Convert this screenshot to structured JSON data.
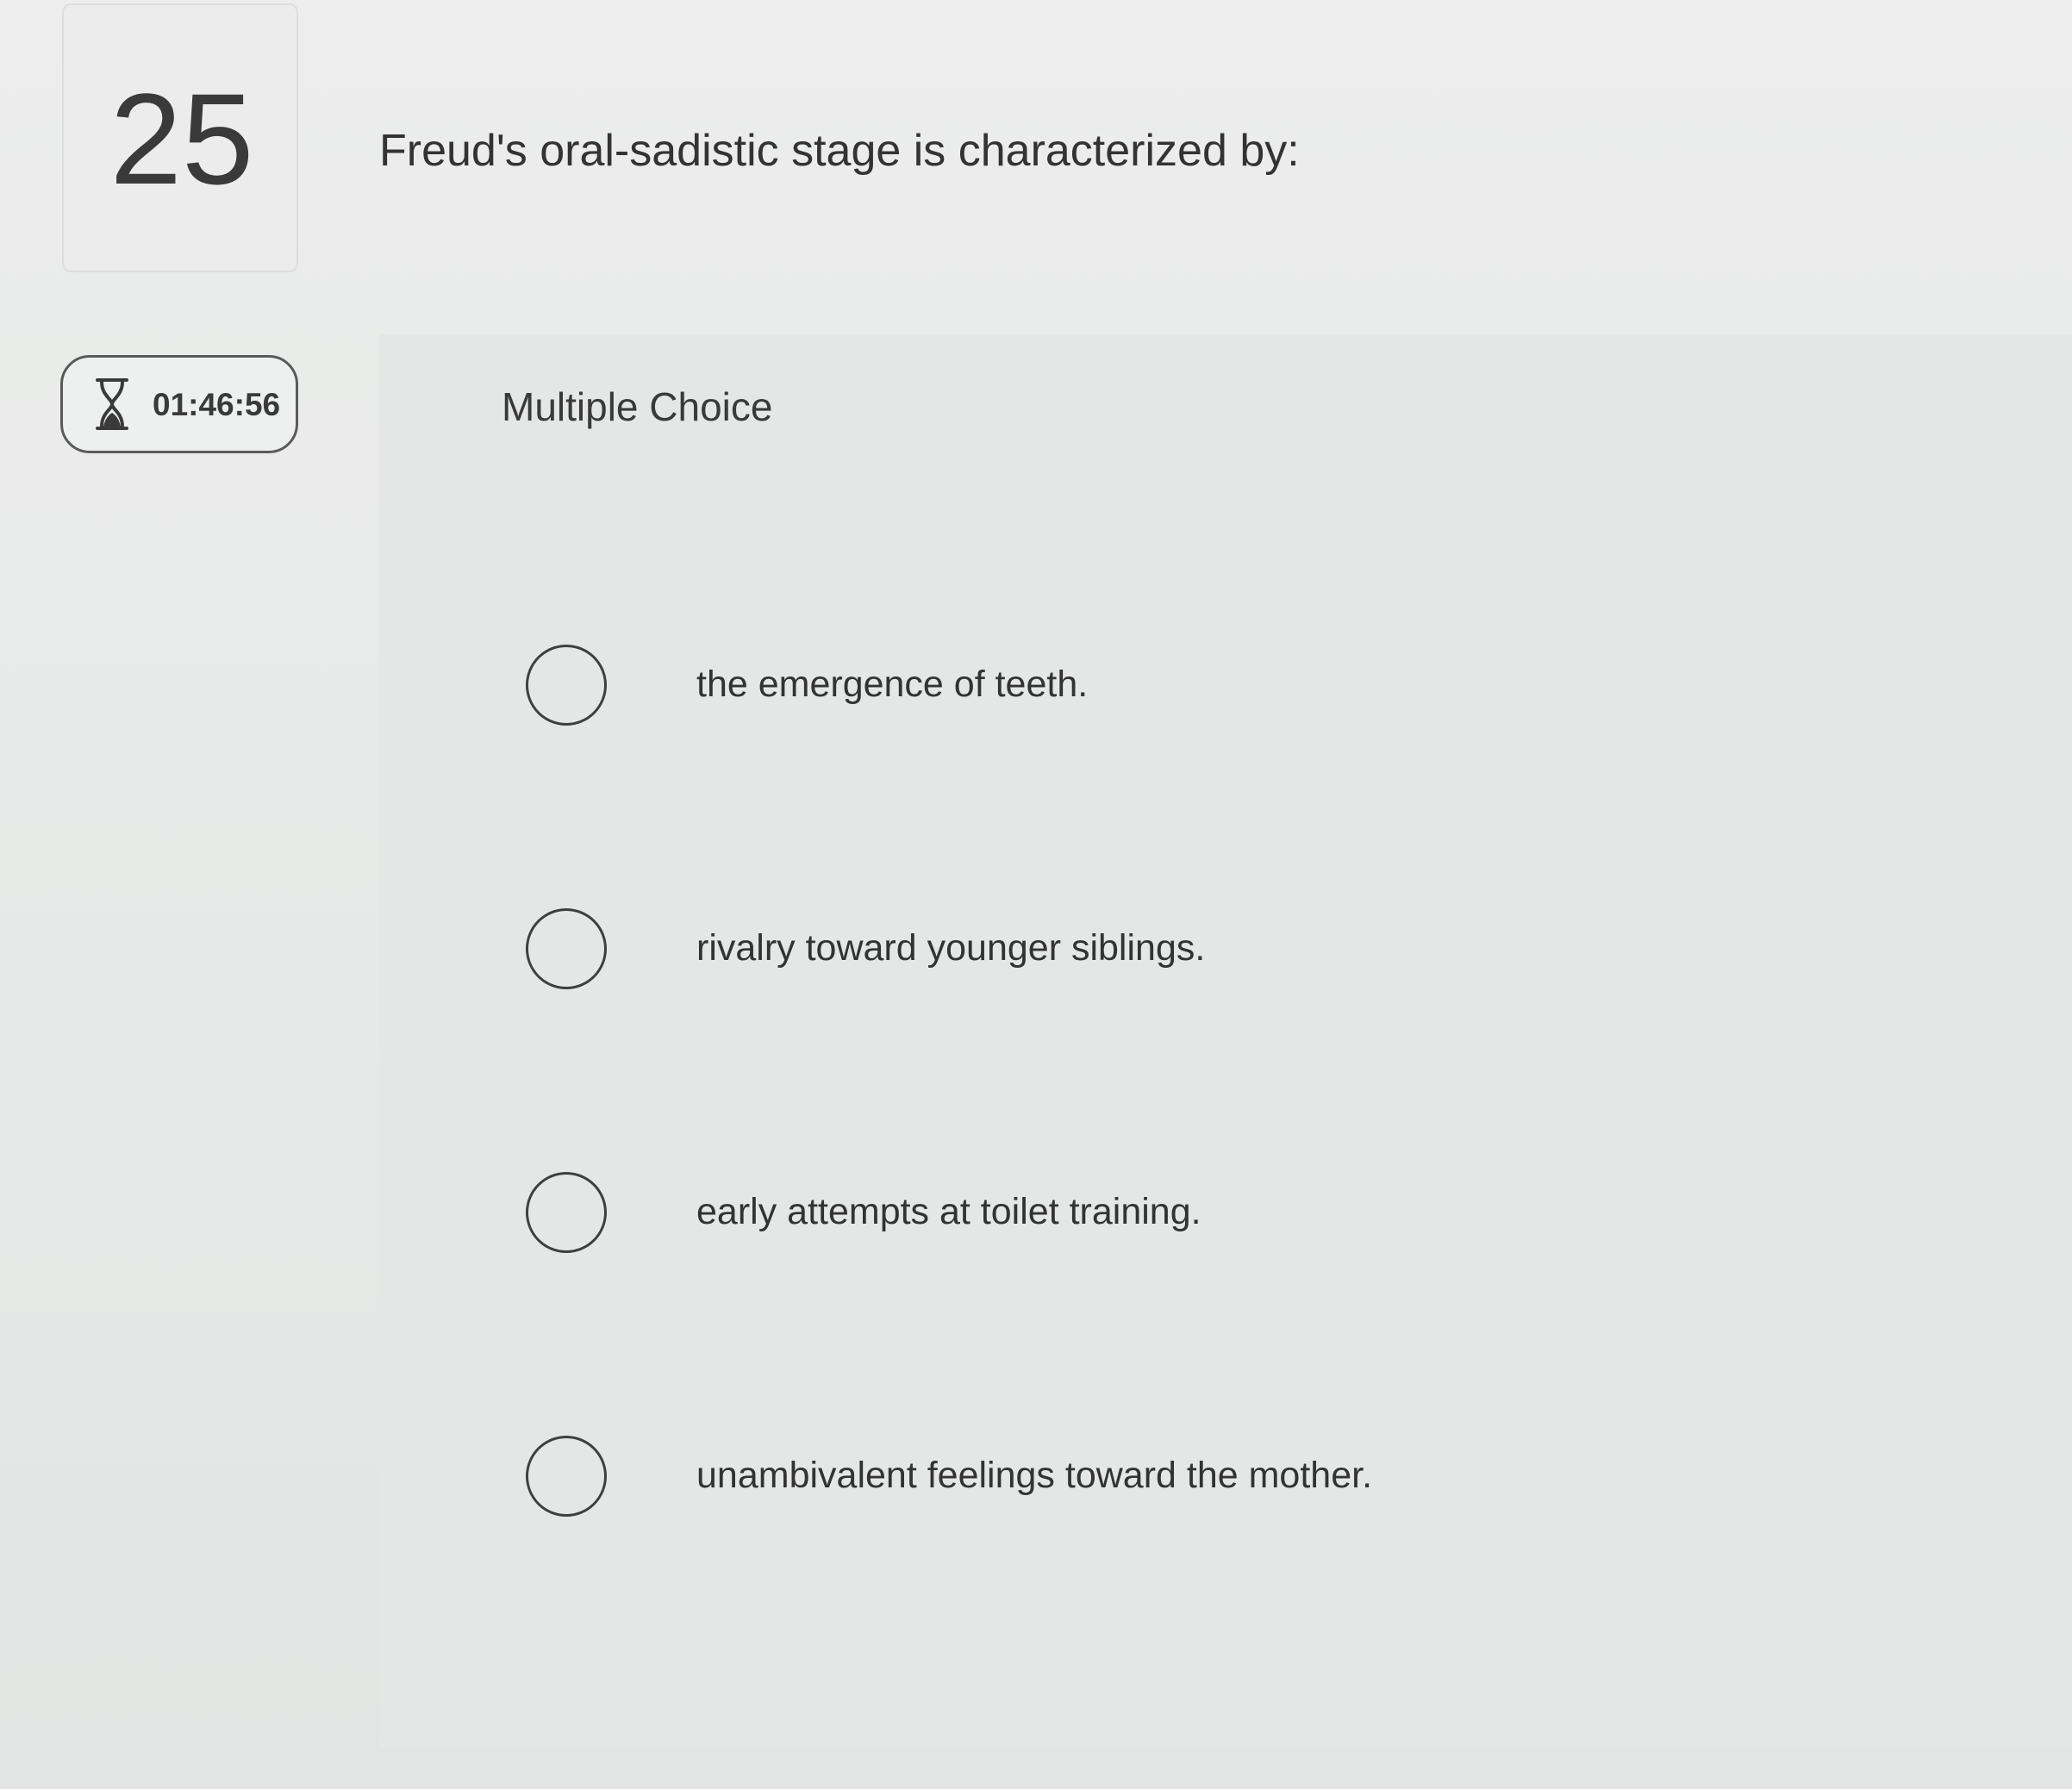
{
  "question": {
    "number": "25",
    "text": "Freud's oral-sadistic stage is characterized by:",
    "type_label": "Multiple Choice"
  },
  "timer": {
    "icon": "hourglass-icon",
    "time": "01:46:56"
  },
  "options": [
    {
      "label": "the emergence of teeth.",
      "selected": false
    },
    {
      "label": "rivalry toward younger siblings.",
      "selected": false
    },
    {
      "label": "early attempts at toilet training.",
      "selected": false
    },
    {
      "label": "unambivalent feelings toward the mother.",
      "selected": false
    }
  ],
  "colors": {
    "background": "#e9ebea",
    "text": "#333333",
    "radio_border": "#3f3f3f"
  }
}
